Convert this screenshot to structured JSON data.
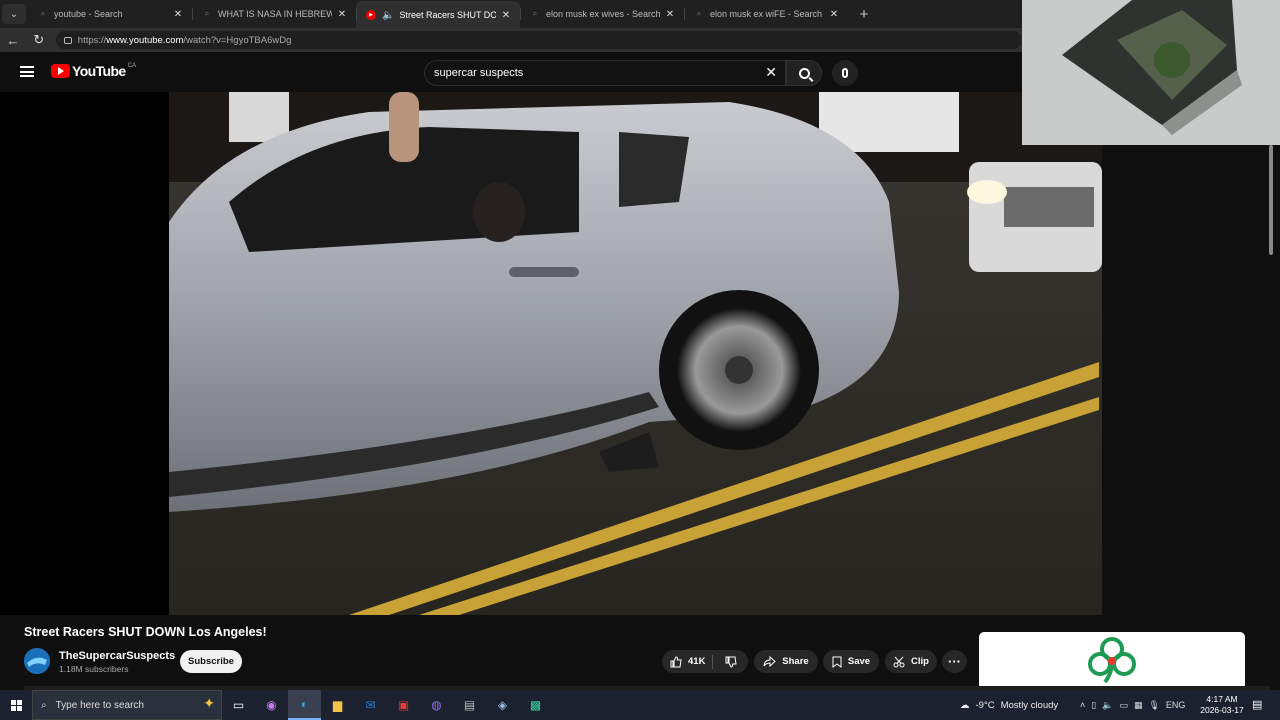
{
  "browser": {
    "tabs": [
      {
        "title": "youtube - Search",
        "active": false,
        "icon": "search-icon"
      },
      {
        "title": "WHAT IS NASA IN HEBREW - Search",
        "active": false,
        "icon": "search-icon"
      },
      {
        "title": "Street Racers SHUT DOWN Los Angeles!",
        "active": true,
        "icon": "youtube-icon",
        "audio": true
      },
      {
        "title": "elon musk ex wives - Search",
        "active": false,
        "icon": "search-icon"
      },
      {
        "title": "elon musk ex wiFE - Search Images",
        "active": false,
        "icon": "search-icon"
      }
    ],
    "url_prefix": "https://",
    "url_host": "www.youtube.com",
    "url_path": "/watch?v=HgyoTBA6wDg"
  },
  "youtube": {
    "logo_text": "YouTube",
    "logo_country": "CA",
    "search_value": "supercar suspects"
  },
  "video": {
    "title": "Street Racers SHUT DOWN Los Angeles!",
    "channel": "TheSupercarSuspects",
    "subscribers": "1.18M subscribers",
    "subscribe_label": "Subscribe",
    "likes": "41K",
    "share_label": "Share",
    "save_label": "Save",
    "clip_label": "Clip"
  },
  "taskbar": {
    "search_placeholder": "Type here to search",
    "weather_temp": "-9°C",
    "weather_desc": "Mostly cloudy",
    "language": "ENG",
    "time": "4:17 AM",
    "date": "2026-03-17"
  },
  "colors": {
    "youtube_red": "#ff0000",
    "background": "#0f0f0f",
    "pill": "#272727",
    "taskbar": "#1c2130"
  }
}
